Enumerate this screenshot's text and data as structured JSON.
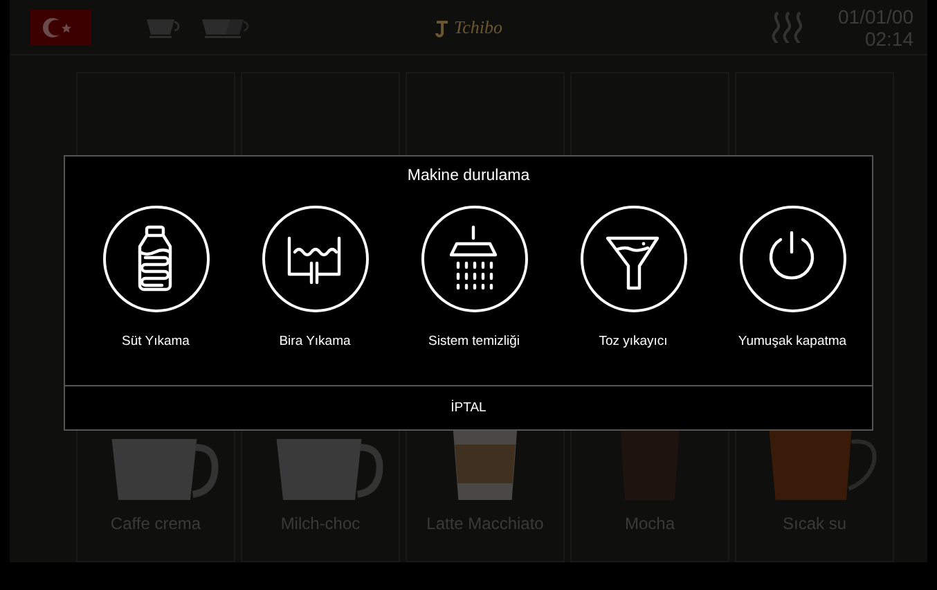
{
  "top_bar": {
    "logo": "Tchibo",
    "date": "01/01/00",
    "time": "02:14"
  },
  "products": [
    {
      "name": "Caffe crema",
      "kind": "mug"
    },
    {
      "name": "Milch-choc",
      "kind": "mug"
    },
    {
      "name": "Latte Macchiato",
      "kind": "latte"
    },
    {
      "name": "Mocha",
      "kind": "mocha"
    },
    {
      "name": "Sıcak su",
      "kind": "tea"
    }
  ],
  "dialog": {
    "title": "Makine durulama",
    "options": [
      {
        "label": "Süt Yıkama",
        "kind": "bottle"
      },
      {
        "label": "Bira Yıkama",
        "kind": "tank"
      },
      {
        "label": "Sistem temizliği",
        "kind": "shower"
      },
      {
        "label": "Toz yıkayıcı",
        "kind": "funnel"
      },
      {
        "label": "Yumuşak kapatma",
        "kind": "power"
      }
    ],
    "cancel": "İPTAL"
  }
}
